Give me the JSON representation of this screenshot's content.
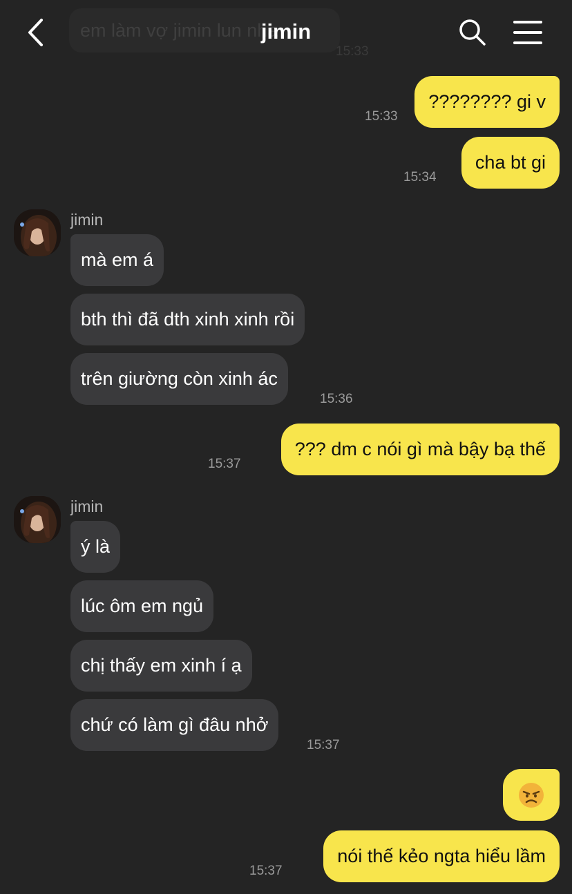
{
  "header": {
    "title": "jimin",
    "ghost_message": "em làm vợ jimin lun nha",
    "ghost_time": "15:33"
  },
  "messages": [
    {
      "side": "mine",
      "text": "???????? gi v",
      "time": "15:33"
    },
    {
      "side": "mine",
      "text": "cha bt gi",
      "time": "15:34"
    },
    {
      "side": "theirs",
      "sender": "jimin",
      "text": "mà em á"
    },
    {
      "side": "theirs",
      "text": "bth thì đã dth xinh xinh rồi"
    },
    {
      "side": "theirs",
      "text": "trên giường còn xinh ác",
      "time": "15:36"
    },
    {
      "side": "mine",
      "text": "??? dm c nói gì mà bậy bạ thế",
      "time": "15:37"
    },
    {
      "side": "theirs",
      "sender": "jimin",
      "text": "ý là"
    },
    {
      "side": "theirs",
      "text": "lúc ôm em ngủ"
    },
    {
      "side": "theirs",
      "text": "chị thấy em xinh í ạ"
    },
    {
      "side": "theirs",
      "text": "chứ có làm gì đâu nhở",
      "time": "15:37"
    },
    {
      "side": "mine",
      "emoji": "angry-face"
    },
    {
      "side": "mine",
      "text": "nói thế kẻo ngta hiểu lầm",
      "time": "15:37"
    }
  ],
  "colors": {
    "background": "#242424",
    "my_bubble": "#f8e54c",
    "their_bubble": "#3a3a3c"
  },
  "icons": [
    "back-chevron-icon",
    "search-icon",
    "menu-icon",
    "angry-face-emoji"
  ]
}
